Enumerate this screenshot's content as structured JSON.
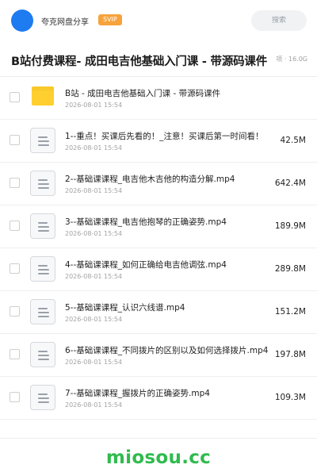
{
  "header": {
    "brand": "夸克网盘分享",
    "badge": "SVIP",
    "search_placeholder": "搜索"
  },
  "folder_header": {
    "title": "B站付费课程- 成田电吉他基础入门课 - 带源码课件",
    "meta": "项 · 16.0G"
  },
  "files": [
    {
      "name": "B站 - 成田电吉他基础入门课 - 带源码课件",
      "date": "2026-08-01 15:54",
      "size": "",
      "type": "folder"
    },
    {
      "name": "1--重点！买课后先看的！_注意！买课后第一时间看！",
      "date": "2026-08-01 15:54",
      "size": "42.5M",
      "type": "file"
    },
    {
      "name": "2--基础课课程_电吉他木吉他的构造分解.mp4",
      "date": "2026-08-01 15:54",
      "size": "642.4M",
      "type": "file"
    },
    {
      "name": "3--基础课课程_电吉他抱琴的正确姿势.mp4",
      "date": "2026-08-01 15:54",
      "size": "189.9M",
      "type": "file"
    },
    {
      "name": "4--基础课课程_如何正确给电吉他调弦.mp4",
      "date": "2026-08-01 15:54",
      "size": "289.8M",
      "type": "file"
    },
    {
      "name": "5--基础课课程_认识六线谱.mp4",
      "date": "2026-08-01 15:54",
      "size": "151.2M",
      "type": "file"
    },
    {
      "name": "6--基础课课程_不同拨片的区别以及如何选择拨片.mp4",
      "date": "2026-08-01 15:54",
      "size": "197.8M",
      "type": "file"
    },
    {
      "name": "7--基础课课程_握拨片的正确姿势.mp4",
      "date": "2026-08-01 15:54",
      "size": "109.3M",
      "type": "file"
    }
  ],
  "watermark": "miosou.cc"
}
